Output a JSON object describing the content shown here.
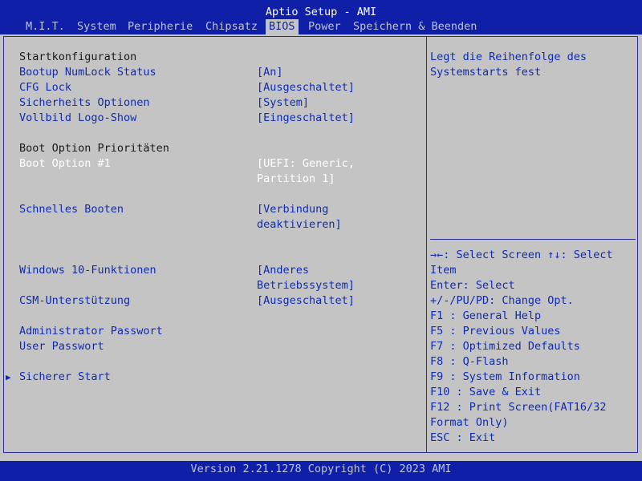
{
  "title": "Aptio Setup - AMI",
  "tabs": [
    "M.I.T.",
    "System",
    "Peripherie",
    "Chipsatz",
    "BIOS",
    "Power",
    "Speichern & Beenden"
  ],
  "active_tab": "BIOS",
  "settings": {
    "section_startkonfiguration": "Startkonfiguration",
    "bootup_numlock": {
      "label": "Bootup NumLock Status",
      "value": "[An]"
    },
    "cfg_lock": {
      "label": "CFG Lock",
      "value": "[Ausgeschaltet]"
    },
    "sicherheits_optionen": {
      "label": "Sicherheits Optionen",
      "value": "[System]"
    },
    "vollbild_logo": {
      "label": "Vollbild Logo-Show",
      "value": "[Eingeschaltet]"
    },
    "section_boot_prio": "Boot Option Prioritäten",
    "boot_option_1": {
      "label": "Boot Option #1",
      "value_line1": "[UEFI: Generic,",
      "value_line2": "Partition 1]"
    },
    "schnelles_booten": {
      "label": "Schnelles Booten",
      "value_line1": "[Verbindung",
      "value_line2": "deaktivieren]"
    },
    "windows10": {
      "label": "Windows 10-Funktionen",
      "value_line1": "[Anderes",
      "value_line2": "Betriebssystem]"
    },
    "csm": {
      "label": "CSM-Unterstützung",
      "value": "[Ausgeschaltet]"
    },
    "admin_passwort": {
      "label": "Administrator Passwort"
    },
    "user_passwort": {
      "label": "User Passwort"
    },
    "sicherer_start": {
      "label": "Sicherer Start",
      "arrow": "▶"
    }
  },
  "help": {
    "description_line1": "Legt die Reihenfolge des",
    "description_line2": "Systemstarts fest",
    "keys": [
      "→←: Select Screen  ↑↓: Select",
      "Item",
      "Enter: Select",
      "+/-/PU/PD: Change Opt.",
      "F1  : General Help",
      "F5  : Previous Values",
      "F7  : Optimized Defaults",
      "F8  : Q-Flash",
      "F9  : System Information",
      "F10 : Save & Exit",
      "F12 : Print Screen(FAT16/32",
      "Format Only)",
      "ESC : Exit"
    ]
  },
  "footer": "Version 2.21.1278 Copyright (C) 2023 AMI",
  "colors": {
    "header_bg": "#0f1fa8",
    "panel_bg": "#c4c4c4",
    "item_blue": "#0f2bb0",
    "static_text": "#1a1a1a"
  }
}
